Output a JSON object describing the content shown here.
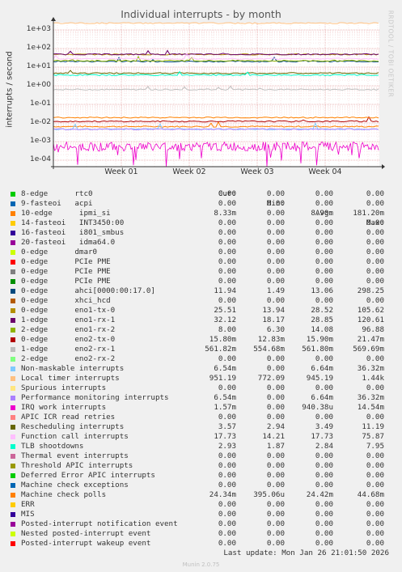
{
  "title": "Individual interrupts - by month",
  "ylabel": "interrupts / second",
  "watermark": "RRDTOOL / TOBI OETIKER",
  "footer": "Munin 2.0.75",
  "last_update": "Last update: Mon Jan 26 21:01:50 2026",
  "columns": {
    "cur": "Cur:",
    "min": "Min:",
    "avg": "Avg:",
    "max": "Max:"
  },
  "chart_data": {
    "type": "line",
    "title": "Individual interrupts - by month",
    "ylabel": "interrupts / second",
    "yscale": "log",
    "ylim": [
      0.0001,
      1000
    ],
    "yticks": [
      "1e+03",
      "1e+02",
      "1e+01",
      "1e+00",
      "1e-01",
      "1e-02",
      "1e-03",
      "1e-04"
    ],
    "xticks": [
      "Week 01",
      "Week 02",
      "Week 03",
      "Week 04"
    ],
    "grid": true,
    "legend": [
      {
        "name": "8-edge      rtc0",
        "color": "#00cc00",
        "cur": "0.00",
        "min": "0.00",
        "avg": "0.00",
        "max": "0.00"
      },
      {
        "name": "9-fasteoi   acpi",
        "color": "#0066b3",
        "cur": "0.00",
        "min": "0.00",
        "avg": "0.00",
        "max": "0.00"
      },
      {
        "name": "10-edge      ipmi_si",
        "color": "#ff8000",
        "cur": "8.33m",
        "min": "0.00",
        "avg": "8.90m",
        "max": "181.20m"
      },
      {
        "name": "14-fasteoi   INT3450:00",
        "color": "#ffcc00",
        "cur": "0.00",
        "min": "0.00",
        "avg": "0.00",
        "max": "0.00"
      },
      {
        "name": "16-fasteoi   i801_smbus",
        "color": "#330099",
        "cur": "0.00",
        "min": "0.00",
        "avg": "0.00",
        "max": "0.00"
      },
      {
        "name": "20-fasteoi   idma64.0",
        "color": "#990099",
        "cur": "0.00",
        "min": "0.00",
        "avg": "0.00",
        "max": "0.00"
      },
      {
        "name": "0-edge      dmar0",
        "color": "#ccff00",
        "cur": "0.00",
        "min": "0.00",
        "avg": "0.00",
        "max": "0.00"
      },
      {
        "name": "0-edge      PCIe PME",
        "color": "#ff0000",
        "cur": "0.00",
        "min": "0.00",
        "avg": "0.00",
        "max": "0.00"
      },
      {
        "name": "0-edge      PCIe PME",
        "color": "#808080",
        "cur": "0.00",
        "min": "0.00",
        "avg": "0.00",
        "max": "0.00"
      },
      {
        "name": "0-edge      PCIe PME",
        "color": "#008f00",
        "cur": "0.00",
        "min": "0.00",
        "avg": "0.00",
        "max": "0.00"
      },
      {
        "name": "0-edge      ahci[0000:00:17.0]",
        "color": "#00487d",
        "cur": "11.94",
        "min": "1.49",
        "avg": "13.06",
        "max": "298.25"
      },
      {
        "name": "0-edge      xhci_hcd",
        "color": "#b35a00",
        "cur": "0.00",
        "min": "0.00",
        "avg": "0.00",
        "max": "0.00"
      },
      {
        "name": "0-edge      eno1-tx-0",
        "color": "#b38f00",
        "cur": "25.51",
        "min": "13.94",
        "avg": "28.52",
        "max": "105.62"
      },
      {
        "name": "1-edge      eno1-rx-1",
        "color": "#6b006b",
        "cur": "32.12",
        "min": "18.17",
        "avg": "28.85",
        "max": "120.61"
      },
      {
        "name": "2-edge      eno1-rx-2",
        "color": "#8fb300",
        "cur": "8.00",
        "min": "6.30",
        "avg": "14.08",
        "max": "96.88"
      },
      {
        "name": "0-edge      eno2-tx-0",
        "color": "#b30000",
        "cur": "15.80m",
        "min": "12.83m",
        "avg": "15.90m",
        "max": "21.47m"
      },
      {
        "name": "1-edge      eno2-rx-1",
        "color": "#bebebe",
        "cur": "561.82m",
        "min": "554.68m",
        "avg": "561.80m",
        "max": "569.69m"
      },
      {
        "name": "2-edge      eno2-rx-2",
        "color": "#80ff80",
        "cur": "0.00",
        "min": "0.00",
        "avg": "0.00",
        "max": "0.00"
      },
      {
        "name": "Non-maskable interrupts",
        "color": "#80c9ff",
        "cur": "6.54m",
        "min": "0.00",
        "avg": "6.64m",
        "max": "36.32m"
      },
      {
        "name": "Local timer interrupts",
        "color": "#ffc080",
        "cur": "951.19",
        "min": "772.09",
        "avg": "945.19",
        "max": "1.44k"
      },
      {
        "name": "Spurious interrupts",
        "color": "#ffe680",
        "cur": "0.00",
        "min": "0.00",
        "avg": "0.00",
        "max": "0.00"
      },
      {
        "name": "Performance monitoring interrupts",
        "color": "#aa80ff",
        "cur": "6.54m",
        "min": "0.00",
        "avg": "6.64m",
        "max": "36.32m"
      },
      {
        "name": "IRQ work interrupts",
        "color": "#ee00cc",
        "cur": "1.57m",
        "min": "0.00",
        "avg": "940.38u",
        "max": "14.54m"
      },
      {
        "name": "APIC ICR read retries",
        "color": "#ff8080",
        "cur": "0.00",
        "min": "0.00",
        "avg": "0.00",
        "max": "0.00"
      },
      {
        "name": "Rescheduling interrupts",
        "color": "#666600",
        "cur": "3.57",
        "min": "2.94",
        "avg": "3.49",
        "max": "11.19"
      },
      {
        "name": "Function call interrupts",
        "color": "#ffbfff",
        "cur": "17.73",
        "min": "14.21",
        "avg": "17.73",
        "max": "75.87"
      },
      {
        "name": "TLB shootdowns",
        "color": "#00ffcc",
        "cur": "2.93",
        "min": "1.87",
        "avg": "2.84",
        "max": "7.95"
      },
      {
        "name": "Thermal event interrupts",
        "color": "#cc6699",
        "cur": "0.00",
        "min": "0.00",
        "avg": "0.00",
        "max": "0.00"
      },
      {
        "name": "Threshold APIC interrupts",
        "color": "#999900",
        "cur": "0.00",
        "min": "0.00",
        "avg": "0.00",
        "max": "0.00"
      },
      {
        "name": "Deferred Error APIC interrupts",
        "color": "#00cc00",
        "cur": "0.00",
        "min": "0.00",
        "avg": "0.00",
        "max": "0.00"
      },
      {
        "name": "Machine check exceptions",
        "color": "#0066b3",
        "cur": "0.00",
        "min": "0.00",
        "avg": "0.00",
        "max": "0.00"
      },
      {
        "name": "Machine check polls",
        "color": "#ff8000",
        "cur": "24.34m",
        "min": "395.06u",
        "avg": "24.42m",
        "max": "44.68m"
      },
      {
        "name": "ERR",
        "color": "#ffcc00",
        "cur": "0.00",
        "min": "0.00",
        "avg": "0.00",
        "max": "0.00"
      },
      {
        "name": "MIS",
        "color": "#330099",
        "cur": "0.00",
        "min": "0.00",
        "avg": "0.00",
        "max": "0.00"
      },
      {
        "name": "Posted-interrupt notification event",
        "color": "#990099",
        "cur": "0.00",
        "min": "0.00",
        "avg": "0.00",
        "max": "0.00"
      },
      {
        "name": "Nested posted-interrupt event",
        "color": "#ccff00",
        "cur": "0.00",
        "min": "0.00",
        "avg": "0.00",
        "max": "0.00"
      },
      {
        "name": "Posted-interrupt wakeup event",
        "color": "#ff0000",
        "cur": "0.00",
        "min": "0.00",
        "avg": "0.00",
        "max": "0.00"
      }
    ]
  }
}
